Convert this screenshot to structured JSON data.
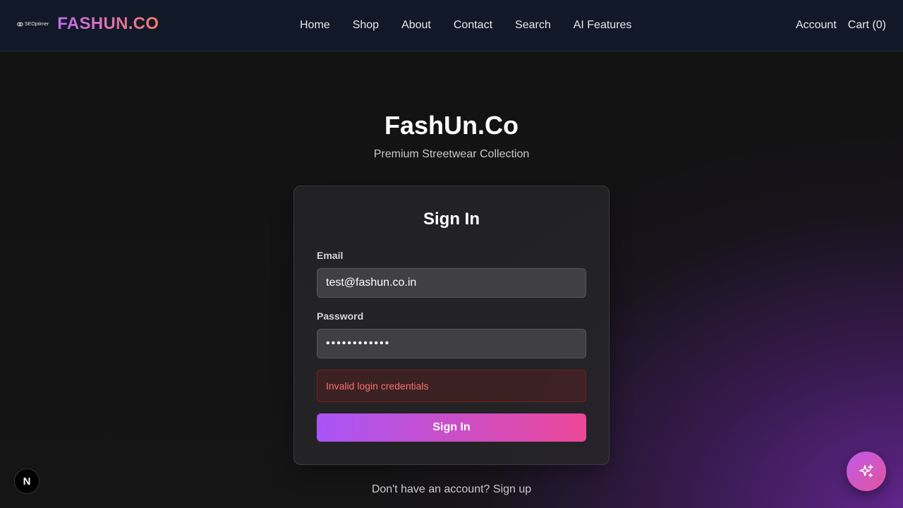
{
  "header": {
    "seo_logo_text": "SEOptimer",
    "brand": "FASHUN.CO",
    "nav": [
      {
        "label": "Home"
      },
      {
        "label": "Shop"
      },
      {
        "label": "About"
      },
      {
        "label": "Contact"
      },
      {
        "label": "Search"
      },
      {
        "label": "AI Features"
      }
    ],
    "account_label": "Account",
    "cart_label": "Cart (0)"
  },
  "hero": {
    "title": "FashUn.Co",
    "subtitle": "Premium Streetwear Collection"
  },
  "form": {
    "title": "Sign In",
    "email_label": "Email",
    "email_value": "test@fashun.co.in",
    "password_label": "Password",
    "password_value": "••••••••••••",
    "error": "Invalid login credentials",
    "submit_label": "Sign In"
  },
  "footer": {
    "signup_text": "Don't have an account? Sign up"
  },
  "badges": {
    "next_letter": "N"
  },
  "icons": {
    "ai_fab": "sparkles-icon",
    "seo_logo": "link-icon"
  },
  "colors": {
    "header_bg": "#111827",
    "brand_gradient_start": "#c26bf0",
    "brand_gradient_end": "#f07a6b",
    "button_gradient_start": "#a855f7",
    "button_gradient_end": "#ec4899",
    "error_text": "#f87171"
  }
}
